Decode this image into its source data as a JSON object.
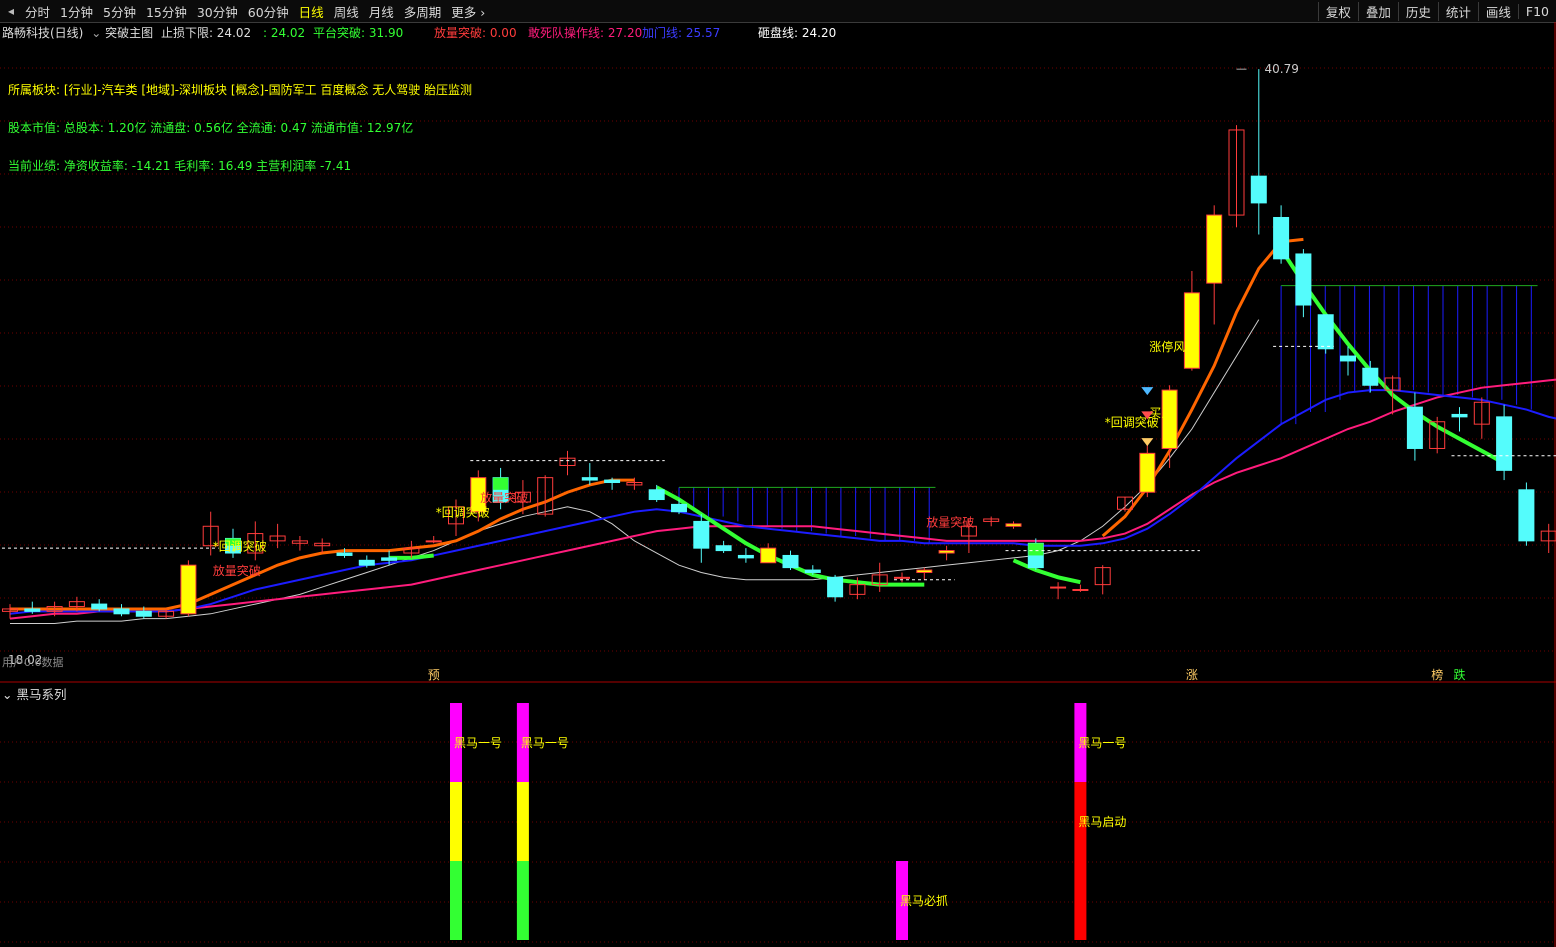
{
  "toolbar": {
    "left_items": [
      "分时",
      "1分钟",
      "5分钟",
      "15分钟",
      "30分钟",
      "60分钟",
      "日线",
      "周线",
      "月线",
      "多周期",
      "更多 ›"
    ],
    "active": "日线",
    "right_items": [
      "复权",
      "叠加",
      "历史",
      "统计",
      "画线",
      "F10"
    ]
  },
  "header": {
    "stock": "路畅科技(日线)",
    "indicator": "突破主图",
    "stoploss": "止损下限: 24.02",
    "v1": ": 24.02",
    "platform": "平台突破: 31.90",
    "fangliang": "放量突破: 0.00",
    "gansi": "敢死队操作线: 27.20",
    "jiama": "加门线: 25.57",
    "zapan": "砸盘线: 24.20"
  },
  "info": {
    "sector": "所属板块: [行业]-汽车类 [地域]-深圳板块 [概念]-国防军工 百度概念 无人驾驶 胎压监测",
    "market": "股本市值: 总股本: 1.20亿 流通盘: 0.56亿 全流通: 0.47 流通市值: 12.97亿",
    "perf": "当前业绩: 净资收益率: -14.21 毛利率: 16.49 主营利润率 -7.41"
  },
  "colors": {
    "bg": "#000000",
    "up": "#ff3c3c",
    "down": "#54fcfc",
    "grid": "#6e0000",
    "yellow": "#ffff00",
    "green": "#33ff33",
    "magenta": "#ff00ff",
    "red": "#ff0000",
    "ma_orange": "#ff6600",
    "ma_blue": "#1c1cff",
    "ma_pink": "#ff1c7c",
    "ma_white": "#cfcfcf"
  },
  "chart_data": [
    {
      "type": "candlestick",
      "y_range": [
        16.5,
        42.0
      ],
      "max_label": "40.79",
      "min_label": "18.02",
      "bottom_left_text": "用户0.0数据",
      "candles": [
        {
          "o": 18.5,
          "h": 18.8,
          "l": 18.2,
          "c": 18.6
        },
        {
          "o": 18.6,
          "h": 18.9,
          "l": 18.4,
          "c": 18.5
        },
        {
          "o": 18.5,
          "h": 18.9,
          "l": 18.3,
          "c": 18.7
        },
        {
          "o": 18.7,
          "h": 19.1,
          "l": 18.5,
          "c": 18.9
        },
        {
          "o": 18.8,
          "h": 19.0,
          "l": 18.5,
          "c": 18.6
        },
        {
          "o": 18.6,
          "h": 18.8,
          "l": 18.3,
          "c": 18.4
        },
        {
          "o": 18.5,
          "h": 18.7,
          "l": 18.2,
          "c": 18.3
        },
        {
          "o": 18.3,
          "h": 18.6,
          "l": 18.2,
          "c": 18.5
        },
        {
          "o": 18.4,
          "h": 20.6,
          "l": 18.3,
          "c": 20.4
        },
        {
          "o": 21.2,
          "h": 22.6,
          "l": 20.8,
          "c": 22.0
        },
        {
          "o": 21.5,
          "h": 21.9,
          "l": 20.7,
          "c": 20.9
        },
        {
          "o": 20.9,
          "h": 22.2,
          "l": 20.6,
          "c": 21.7
        },
        {
          "o": 21.4,
          "h": 22.1,
          "l": 21.1,
          "c": 21.6
        },
        {
          "o": 21.3,
          "h": 21.6,
          "l": 21.0,
          "c": 21.4
        },
        {
          "o": 21.2,
          "h": 21.5,
          "l": 20.9,
          "c": 21.3
        },
        {
          "o": 20.9,
          "h": 21.1,
          "l": 20.7,
          "c": 20.8
        },
        {
          "o": 20.6,
          "h": 20.8,
          "l": 20.3,
          "c": 20.4
        },
        {
          "o": 20.7,
          "h": 21.0,
          "l": 20.4,
          "c": 20.6
        },
        {
          "o": 20.9,
          "h": 21.4,
          "l": 20.7,
          "c": 21.1
        },
        {
          "o": 21.4,
          "h": 21.6,
          "l": 21.3,
          "c": 21.4
        },
        {
          "o": 22.1,
          "h": 23.1,
          "l": 21.6,
          "c": 22.8
        },
        {
          "o": 22.6,
          "h": 24.3,
          "l": 22.2,
          "c": 24.0
        },
        {
          "o": 24.0,
          "h": 24.4,
          "l": 22.7,
          "c": 23.0
        },
        {
          "o": 23.0,
          "h": 23.9,
          "l": 22.5,
          "c": 23.4
        },
        {
          "o": 22.5,
          "h": 24.1,
          "l": 22.4,
          "c": 24.0
        },
        {
          "o": 24.5,
          "h": 25.1,
          "l": 24.1,
          "c": 24.8
        },
        {
          "o": 24.0,
          "h": 24.6,
          "l": 23.7,
          "c": 23.9
        },
        {
          "o": 23.9,
          "h": 24.0,
          "l": 23.5,
          "c": 23.8
        },
        {
          "o": 23.7,
          "h": 24.0,
          "l": 23.5,
          "c": 23.8
        },
        {
          "o": 23.5,
          "h": 23.7,
          "l": 23.0,
          "c": 23.1
        },
        {
          "o": 22.9,
          "h": 23.1,
          "l": 22.5,
          "c": 22.6
        },
        {
          "o": 22.2,
          "h": 22.5,
          "l": 20.5,
          "c": 21.1
        },
        {
          "o": 21.2,
          "h": 21.4,
          "l": 20.9,
          "c": 21.0
        },
        {
          "o": 20.8,
          "h": 21.1,
          "l": 20.5,
          "c": 20.7
        },
        {
          "o": 20.5,
          "h": 21.3,
          "l": 20.5,
          "c": 21.1
        },
        {
          "o": 20.8,
          "h": 21.0,
          "l": 20.2,
          "c": 20.3
        },
        {
          "o": 20.2,
          "h": 20.4,
          "l": 20.0,
          "c": 20.1
        },
        {
          "o": 19.9,
          "h": 20.0,
          "l": 18.9,
          "c": 19.1
        },
        {
          "o": 19.2,
          "h": 19.9,
          "l": 19.0,
          "c": 19.6
        },
        {
          "o": 19.6,
          "h": 20.5,
          "l": 19.3,
          "c": 20.0
        },
        {
          "o": 19.9,
          "h": 20.1,
          "l": 19.7,
          "c": 19.9
        },
        {
          "o": 20.1,
          "h": 20.3,
          "l": 19.8,
          "c": 20.2
        },
        {
          "o": 20.9,
          "h": 21.2,
          "l": 20.6,
          "c": 21.0
        },
        {
          "o": 21.6,
          "h": 22.3,
          "l": 20.9,
          "c": 22.0
        },
        {
          "o": 22.2,
          "h": 22.4,
          "l": 22.0,
          "c": 22.3
        },
        {
          "o": 22.0,
          "h": 22.2,
          "l": 21.9,
          "c": 22.1
        },
        {
          "o": 21.3,
          "h": 21.5,
          "l": 20.2,
          "c": 20.3
        },
        {
          "o": 19.5,
          "h": 19.7,
          "l": 19.0,
          "c": 19.5
        },
        {
          "o": 19.4,
          "h": 19.6,
          "l": 19.3,
          "c": 19.4
        },
        {
          "o": 19.6,
          "h": 20.4,
          "l": 19.2,
          "c": 20.3
        },
        {
          "o": 22.7,
          "h": 23.2,
          "l": 22.6,
          "c": 23.2
        },
        {
          "o": 23.4,
          "h": 25.5,
          "l": 23.2,
          "c": 25.0
        },
        {
          "o": 25.2,
          "h": 27.8,
          "l": 24.4,
          "c": 27.6
        },
        {
          "o": 28.5,
          "h": 32.5,
          "l": 28.4,
          "c": 31.6
        },
        {
          "o": 32.0,
          "h": 35.2,
          "l": 30.3,
          "c": 34.8
        },
        {
          "o": 34.8,
          "h": 38.5,
          "l": 34.3,
          "c": 38.3
        },
        {
          "o": 36.4,
          "h": 40.8,
          "l": 34.0,
          "c": 35.3
        },
        {
          "o": 34.7,
          "h": 35.2,
          "l": 32.8,
          "c": 33.0
        },
        {
          "o": 33.2,
          "h": 33.4,
          "l": 30.6,
          "c": 31.1
        },
        {
          "o": 30.7,
          "h": 30.7,
          "l": 29.1,
          "c": 29.3
        },
        {
          "o": 29.0,
          "h": 29.4,
          "l": 28.2,
          "c": 28.8
        },
        {
          "o": 28.5,
          "h": 28.8,
          "l": 27.5,
          "c": 27.8
        },
        {
          "o": 27.6,
          "h": 28.2,
          "l": 26.6,
          "c": 28.1
        },
        {
          "o": 26.9,
          "h": 27.5,
          "l": 24.7,
          "c": 25.2
        },
        {
          "o": 25.2,
          "h": 26.5,
          "l": 25.0,
          "c": 26.3
        },
        {
          "o": 26.6,
          "h": 26.9,
          "l": 25.9,
          "c": 26.5
        },
        {
          "o": 26.2,
          "h": 27.3,
          "l": 25.6,
          "c": 27.1
        },
        {
          "o": 26.5,
          "h": 27.0,
          "l": 23.9,
          "c": 24.3
        },
        {
          "o": 23.5,
          "h": 23.8,
          "l": 21.2,
          "c": 21.4
        },
        {
          "o": 21.4,
          "h": 22.1,
          "l": 20.9,
          "c": 21.8
        },
        {
          "o": 21.6,
          "h": 22.3,
          "l": 21.2,
          "c": 21.8
        },
        {
          "o": 22.0,
          "h": 23.8,
          "l": 21.6,
          "c": 22.0
        }
      ],
      "filled_yellow": [
        8,
        21,
        22,
        30,
        34,
        41,
        42,
        45,
        48,
        51,
        52,
        53,
        54
      ],
      "filled_green": [
        10,
        22,
        34,
        46,
        49
      ],
      "labels": [
        {
          "i": 9,
          "text": "放量突破",
          "color": "#ff3c3c"
        },
        {
          "i": 9,
          "text": "*回调突破",
          "color": "#ffff00"
        },
        {
          "i": 19,
          "text": "*回调突破",
          "color": "#ffff00"
        },
        {
          "i": 21,
          "text": "放量突破",
          "color": "#ff3c3c"
        },
        {
          "i": 41,
          "text": "放量突破",
          "color": "#ff3c3c"
        },
        {
          "i": 49,
          "text": "*回调突破",
          "color": "#ffff00"
        },
        {
          "i": 51,
          "text": "买入",
          "color": "#ffff00"
        },
        {
          "i": 51,
          "text": "涨停风暴",
          "color": "#ffff00"
        }
      ],
      "bottom_markers": [
        {
          "i": 19,
          "text": "预",
          "color": "#ffcc66"
        },
        {
          "i": 53,
          "text": "涨",
          "color": "#ffcc66"
        },
        {
          "i": 64,
          "text": "榜",
          "color": "#ffcc66"
        },
        {
          "i": 65,
          "text": "跌",
          "color": "#33ff33"
        }
      ],
      "ma_orange": [
        18.6,
        18.6,
        18.6,
        18.6,
        18.6,
        18.6,
        18.6,
        18.6,
        18.8,
        19.2,
        19.6,
        20.0,
        20.4,
        20.7,
        20.9,
        21.0,
        21.0,
        21.0,
        21.1,
        21.2,
        21.4,
        21.8,
        22.3,
        22.7,
        23.0,
        23.4,
        23.7,
        23.9,
        23.9,
        null,
        null,
        null,
        null,
        null,
        null,
        null,
        null,
        null,
        null,
        null,
        null,
        null,
        null,
        null,
        null,
        null,
        null,
        null,
        null,
        21.6,
        22.4,
        23.6,
        25.1,
        26.8,
        28.6,
        30.8,
        32.6,
        33.7,
        33.8
      ],
      "ma_green": [
        null,
        null,
        null,
        null,
        null,
        null,
        null,
        null,
        null,
        null,
        null,
        null,
        null,
        null,
        null,
        null,
        null,
        20.7,
        20.7,
        20.8,
        null,
        null,
        null,
        null,
        null,
        null,
        null,
        null,
        null,
        23.6,
        23.1,
        22.5,
        21.9,
        21.3,
        20.8,
        20.4,
        20.0,
        19.8,
        19.7,
        19.6,
        19.6,
        19.6,
        null,
        null,
        null,
        20.6,
        20.2,
        19.9,
        19.7,
        null,
        null,
        null,
        null,
        null,
        null,
        null,
        null,
        33.4,
        32.0,
        30.7,
        29.5,
        28.4,
        27.4,
        26.7,
        26.1,
        25.6,
        25.1,
        24.6
      ],
      "ma_blue": [
        18.4,
        18.5,
        18.5,
        18.5,
        18.5,
        18.5,
        18.5,
        18.5,
        18.6,
        18.8,
        19.1,
        19.4,
        19.6,
        19.8,
        20.0,
        20.2,
        20.4,
        20.5,
        20.6,
        20.8,
        21.0,
        21.2,
        21.4,
        21.6,
        21.8,
        22.0,
        22.2,
        22.4,
        22.6,
        22.7,
        22.6,
        22.4,
        22.2,
        22.0,
        21.9,
        21.8,
        21.7,
        21.6,
        21.5,
        21.4,
        21.4,
        21.3,
        21.3,
        21.3,
        21.3,
        21.3,
        21.2,
        21.2,
        21.2,
        21.3,
        21.5,
        21.9,
        22.5,
        23.2,
        24.0,
        24.8,
        25.5,
        26.2,
        26.7,
        27.2,
        27.5,
        27.6,
        27.6,
        27.5,
        27.4,
        27.3,
        27.2,
        27.0,
        26.8,
        26.5,
        26.3,
        26.0
      ],
      "ma_pink": [
        18.2,
        18.3,
        18.4,
        18.4,
        18.5,
        18.5,
        18.5,
        18.5,
        18.6,
        18.7,
        18.8,
        18.9,
        19.0,
        19.1,
        19.2,
        19.3,
        19.4,
        19.5,
        19.6,
        19.8,
        20.0,
        20.2,
        20.4,
        20.6,
        20.8,
        21.0,
        21.2,
        21.4,
        21.6,
        21.8,
        21.9,
        22.0,
        22.0,
        22.0,
        22.0,
        22.0,
        22.0,
        21.9,
        21.8,
        21.7,
        21.6,
        21.5,
        21.4,
        21.4,
        21.4,
        21.4,
        21.4,
        21.4,
        21.4,
        21.5,
        21.7,
        22.1,
        22.7,
        23.3,
        23.8,
        24.2,
        24.5,
        24.8,
        25.2,
        25.6,
        26.0,
        26.3,
        26.7,
        27.0,
        27.3,
        27.5,
        27.7,
        27.8,
        27.9,
        28.0,
        28.1,
        28.2
      ],
      "ma_white": [
        18.0,
        18.0,
        18.0,
        18.1,
        18.1,
        18.1,
        18.2,
        18.2,
        18.3,
        18.4,
        18.6,
        18.8,
        19.0,
        19.2,
        19.5,
        19.8,
        20.1,
        20.4,
        20.7,
        21.0,
        21.4,
        21.8,
        22.1,
        22.4,
        22.6,
        22.8,
        22.6,
        22.1,
        21.4,
        20.9,
        20.4,
        20.1,
        19.9,
        19.8,
        19.8,
        19.8,
        19.8,
        19.9,
        20.0,
        20.1,
        20.2,
        20.3,
        20.4,
        20.5,
        20.6,
        20.7,
        20.8,
        21.0,
        21.4,
        22.0,
        22.8,
        23.7,
        24.8,
        26.0,
        27.5,
        29.0,
        30.5,
        null,
        null,
        null,
        null,
        null,
        null,
        null,
        null,
        null,
        null,
        null,
        null,
        null,
        null,
        null
      ]
    },
    {
      "type": "bar",
      "title": "黑马系列",
      "bars": [
        {
          "i": 20,
          "segments": [
            {
              "c": "#33ff33",
              "v": 1
            },
            {
              "c": "#ffff00",
              "v": 1
            },
            {
              "c": "#ff00ff",
              "v": 1
            }
          ],
          "label": "黑马一号"
        },
        {
          "i": 23,
          "segments": [
            {
              "c": "#33ff33",
              "v": 1
            },
            {
              "c": "#ffff00",
              "v": 1
            },
            {
              "c": "#ff00ff",
              "v": 1
            }
          ],
          "label": "黑马一号"
        },
        {
          "i": 40,
          "segments": [
            {
              "c": "#ff00ff",
              "v": 1
            }
          ],
          "label": "黑马必抓"
        },
        {
          "i": 48,
          "segments": [
            {
              "c": "#ff0000",
              "v": 2
            },
            {
              "c": "#ff00ff",
              "v": 1
            }
          ],
          "label": "黑马一号",
          "label2": "黑马启动"
        }
      ]
    }
  ]
}
